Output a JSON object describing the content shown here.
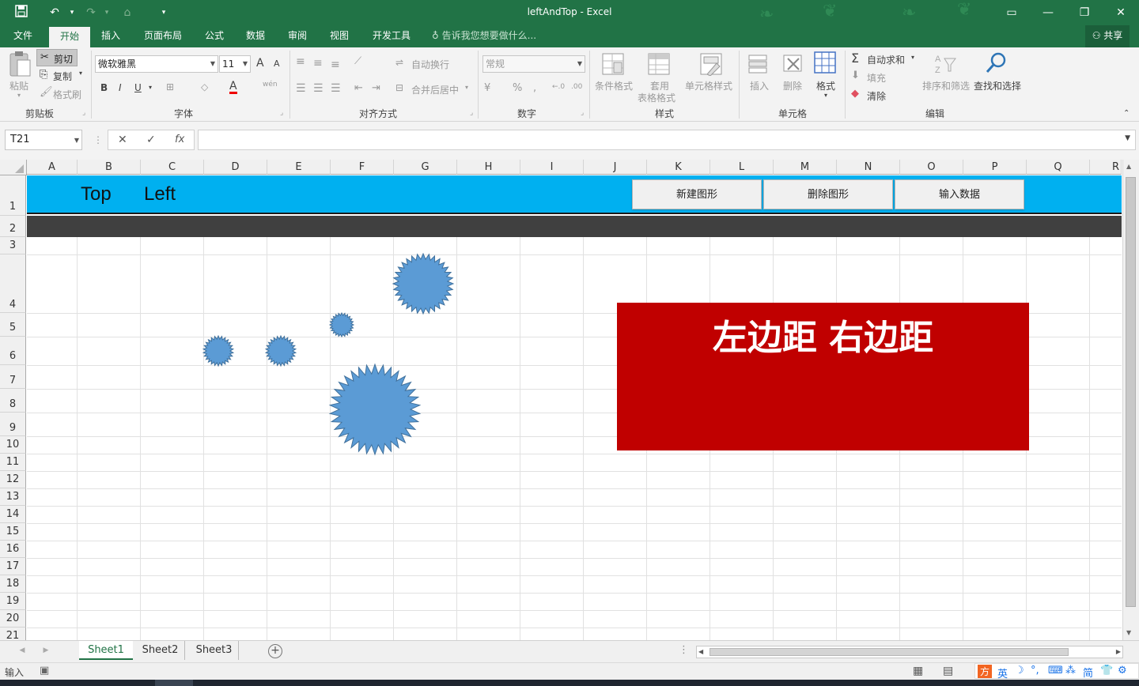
{
  "window": {
    "title": "leftAndTop - Excel",
    "controls": [
      "restore-ribbon",
      "minimize",
      "maximize",
      "close"
    ]
  },
  "quick_access": {
    "save_icon": "save-icon",
    "undo_icon": "undo-icon",
    "redo_icon": "redo-icon",
    "touch_icon": "touch-mode-icon",
    "customize_icon": "customize-icon"
  },
  "menu": {
    "tabs": [
      "文件",
      "开始",
      "插入",
      "页面布局",
      "公式",
      "数据",
      "审阅",
      "视图",
      "开发工具"
    ],
    "active": "开始",
    "tell_me": "告诉我您想要做什么...",
    "share": "共享"
  },
  "ribbon": {
    "clipboard": {
      "paste": "粘贴",
      "cut": "剪切",
      "copy": "复制",
      "format_painter": "格式刷",
      "label": "剪贴板"
    },
    "font": {
      "name": "微软雅黑",
      "size": "11",
      "bold": "B",
      "italic": "I",
      "underline": "U",
      "grow": "A",
      "shrink": "A",
      "font_color": "A",
      "phonetic": "wén",
      "label": "字体"
    },
    "alignment": {
      "wrap": "自动换行",
      "merge": "合并后居中",
      "label": "对齐方式"
    },
    "number": {
      "format": "常规",
      "percent": "%",
      "comma": ",",
      "label": "数字"
    },
    "styles": {
      "conditional": "条件格式",
      "table1": "套用",
      "table2": "表格格式",
      "cell_styles": "单元格样式",
      "label": "样式"
    },
    "cells": {
      "insert": "插入",
      "delete": "删除",
      "format": "格式",
      "label": "单元格"
    },
    "editing": {
      "autosum": "自动求和",
      "fill": "填充",
      "clear": "清除",
      "sort": "排序和筛选",
      "find": "查找和选择",
      "label": "编辑"
    }
  },
  "formula_bar": {
    "name_box": "T21",
    "cancel": "✕",
    "enter": "✓",
    "fx": "fx",
    "content": ""
  },
  "grid": {
    "columns": [
      "A",
      "B",
      "C",
      "D",
      "E",
      "F",
      "G",
      "H",
      "I",
      "J",
      "K",
      "L",
      "M",
      "N",
      "O",
      "P",
      "Q",
      "R"
    ],
    "rows": [
      "1",
      "2",
      "3",
      "4",
      "5",
      "6",
      "7",
      "8",
      "9",
      "10",
      "11",
      "12",
      "13",
      "14",
      "15",
      "16",
      "17",
      "18",
      "19",
      "20",
      "21"
    ],
    "row1": {
      "top_text": "Top",
      "left_text": "Left",
      "fill": "#00b0f0"
    },
    "row2_fill": "#404040",
    "buttons": [
      "新建图形",
      "删除图形",
      "输入数据"
    ],
    "red_box": {
      "text": "左边距 右边距",
      "fill": "#c00000"
    },
    "star_color": "#5b9bd5",
    "star_stroke": "#41719c"
  },
  "sheets": {
    "tabs": [
      "Sheet1",
      "Sheet2",
      "Sheet3"
    ],
    "active": "Sheet1",
    "add": "+"
  },
  "status": {
    "mode": "输入",
    "ime": [
      "英",
      "简"
    ]
  },
  "colors": {
    "excel_green": "#217346",
    "ribbon_bg": "#f3f3f3"
  }
}
